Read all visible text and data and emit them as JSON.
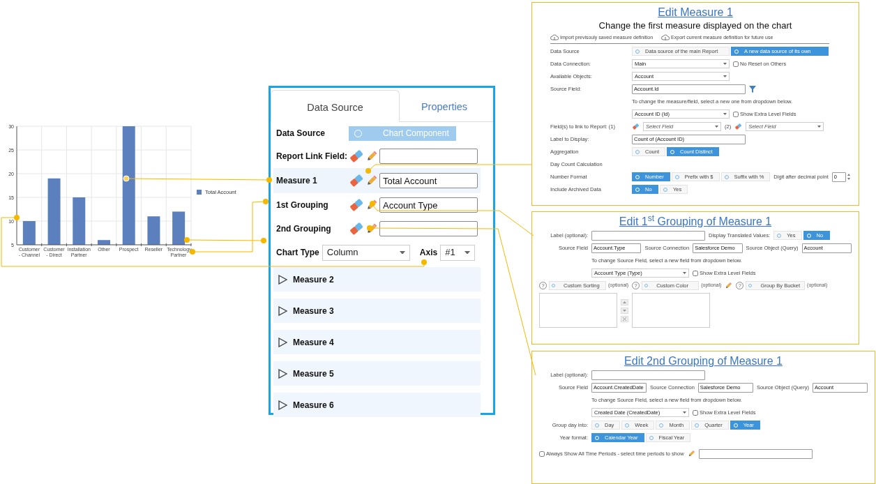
{
  "chart": {
    "chart_data": {
      "type": "bar",
      "categories": [
        "Customer - Channel",
        "Customer - Direct",
        "Installation Partner",
        "Other",
        "Prospect",
        "Reseller",
        "Technology Partner"
      ],
      "series": [
        {
          "name": "Total Account",
          "color": "#5b80bd",
          "values": [
            10,
            19,
            15,
            6,
            30,
            11,
            12
          ]
        }
      ],
      "ylim": [
        5,
        30
      ],
      "yticks": [
        5,
        10,
        15,
        20,
        25,
        30
      ],
      "grid": true
    }
  },
  "panel": {
    "tabs": [
      {
        "label": "Data Source",
        "selected": true
      },
      {
        "label": "Properties",
        "selected": false
      }
    ],
    "data_source": {
      "label": "Data Source",
      "option": {
        "label": "Chart Component",
        "selected": false
      }
    },
    "fields": [
      {
        "label": "Report Link Field:",
        "selected": false
      },
      {
        "label": "Measure 1",
        "value": "Total Account",
        "selected": true
      },
      {
        "label": "1st Grouping",
        "value": "Account Type",
        "selected": false
      },
      {
        "label": "2nd Grouping",
        "selected": false
      }
    ],
    "chart_type": {
      "label": "Chart Type",
      "value": "Column"
    },
    "axis": {
      "label": "Axis",
      "value": "#1"
    },
    "measures": [
      {
        "label": "Measure 2",
        "expanded": false
      },
      {
        "label": "Measure 3",
        "expanded": false
      },
      {
        "label": "Measure 4",
        "expanded": false
      },
      {
        "label": "Measure 5",
        "expanded": false
      },
      {
        "label": "Measure 6",
        "expanded": false
      }
    ]
  },
  "callouts": [
    {
      "title": "Edit Measure 1",
      "subtitle": "Change the first measure displayed on the chart",
      "toolbar": [
        "Import previsouly saved measure definition",
        "Export current measure definition for future use"
      ],
      "rows": [
        {
          "kind": "field",
          "label": "Data Source",
          "items": [
            {
              "kind": "segmented",
              "options": [
                {
                  "label": "Data source of the main Report",
                  "selected": false
                },
                {
                  "label": "A new data source of its own",
                  "selected": true
                }
              ]
            }
          ]
        },
        {
          "kind": "field",
          "label": "Data Connection:",
          "items": [
            {
              "kind": "select",
              "value": "Main"
            },
            {
              "kind": "checkbox",
              "label": "No Reset on Others",
              "checked": false
            }
          ]
        },
        {
          "kind": "field",
          "label": "Available Objects:",
          "items": [
            {
              "kind": "select",
              "value": "Account"
            }
          ]
        },
        {
          "kind": "field",
          "label": "Source Field:",
          "items": [
            {
              "kind": "input",
              "value": "Account.Id"
            },
            {
              "kind": "filter"
            }
          ]
        },
        {
          "kind": "sub",
          "items": [
            {
              "kind": "hint",
              "text": "To change the measure/field, select a new one from dropdown below."
            }
          ]
        },
        {
          "kind": "sub",
          "items": [
            {
              "kind": "select",
              "value": "Account ID (Id)"
            },
            {
              "kind": "checkbox",
              "label": "Show Extra Level Fields",
              "checked": false
            }
          ]
        },
        {
          "kind": "field",
          "label": "Field(s) to link to Report: (1)",
          "items": [
            {
              "kind": "eraser"
            },
            {
              "kind": "select",
              "placeholder": "Select Field"
            },
            {
              "kind": "text",
              "text": "(2)"
            },
            {
              "kind": "eraser"
            },
            {
              "kind": "select",
              "placeholder": "Select Field"
            }
          ]
        },
        {
          "kind": "field",
          "label": "Label to Display:",
          "items": [
            {
              "kind": "input",
              "value": "Count of (Account ID)"
            }
          ]
        },
        {
          "kind": "field",
          "label": "Aggregation",
          "items": [
            {
              "kind": "segmented",
              "options": [
                {
                  "label": "Count",
                  "selected": false
                },
                {
                  "label": "Count Distinct",
                  "selected": true
                }
              ]
            }
          ]
        },
        {
          "kind": "field",
          "label": "Day Count Calculation"
        },
        {
          "kind": "field",
          "label": "Number Format",
          "items": [
            {
              "kind": "segmented",
              "options": [
                {
                  "label": "Number",
                  "selected": true
                },
                {
                  "label": "Prefix with $",
                  "selected": false
                },
                {
                  "label": "Suffix with %",
                  "selected": false
                }
              ]
            },
            {
              "kind": "text",
              "text": "Digit after decimal point"
            },
            {
              "kind": "spinner",
              "value": "0"
            }
          ]
        },
        {
          "kind": "field",
          "label": "Include Archived Data",
          "items": [
            {
              "kind": "segmented",
              "options": [
                {
                  "label": "No",
                  "selected": true
                },
                {
                  "label": "Yes",
                  "selected": false
                }
              ]
            }
          ]
        }
      ]
    },
    {
      "title": "Edit 1$^{st}$ Grouping of Measure 1",
      "rows": [
        {
          "kind": "field",
          "label": "Label (optional):",
          "items": [
            {
              "kind": "input"
            },
            {
              "kind": "text",
              "text": "Display Translated Values:"
            },
            {
              "kind": "segmented",
              "options": [
                {
                  "label": "Yes",
                  "selected": false
                },
                {
                  "label": "No",
                  "selected": true
                }
              ]
            }
          ]
        },
        {
          "kind": "field",
          "label": "Source Field",
          "items": [
            {
              "kind": "input",
              "value": "Account.Type"
            },
            {
              "kind": "text",
              "text": "Source Connection"
            },
            {
              "kind": "input",
              "value": "Salesforce Demo"
            },
            {
              "kind": "text",
              "text": "Source Object (Query)"
            },
            {
              "kind": "input",
              "value": "Account"
            }
          ]
        },
        {
          "kind": "sub",
          "items": [
            {
              "kind": "hint",
              "text": "To change Source Field, select a new field from dropdown below."
            }
          ]
        },
        {
          "kind": "sub",
          "items": [
            {
              "kind": "select",
              "value": "Account Type (Type)"
            },
            {
              "kind": "checkbox",
              "label": "Show Extra Level Fields",
              "checked": false
            }
          ]
        },
        {
          "kind": "plain",
          "items": [
            {
              "kind": "toggle",
              "help": "?",
              "label": "Custom Sorting",
              "selected": false,
              "note": "(optional)"
            },
            {
              "kind": "toggle",
              "help": "?",
              "label": "Custom Color",
              "selected": false,
              "note": "(optional)"
            },
            {
              "kind": "pencil"
            },
            {
              "kind": "toggle",
              "help": "?",
              "label": "Group By Bucket",
              "selected": false,
              "note": "(optional)"
            }
          ]
        },
        {
          "kind": "plain",
          "items": [
            {
              "kind": "listbox"
            },
            {
              "kind": "list_buttons"
            },
            {
              "kind": "listbox"
            }
          ]
        }
      ]
    },
    {
      "title": "Edit 2nd Grouping of Measure 1",
      "rows": [
        {
          "kind": "field",
          "label": "Label (optional):",
          "items": [
            {
              "kind": "input"
            }
          ]
        },
        {
          "kind": "field",
          "label": "Source Field",
          "items": [
            {
              "kind": "input",
              "value": "Account.CreatedDate"
            },
            {
              "kind": "text",
              "text": "Source Connection"
            },
            {
              "kind": "input",
              "value": "Salesforce Demo"
            },
            {
              "kind": "text",
              "text": "Source Object (Query)"
            },
            {
              "kind": "input",
              "value": "Account"
            }
          ]
        },
        {
          "kind": "sub",
          "items": [
            {
              "kind": "hint",
              "text": "To change Source Field, select a new field from dropdown below."
            }
          ]
        },
        {
          "kind": "sub",
          "items": [
            {
              "kind": "select",
              "value": "Created Date (CreatedDate)"
            },
            {
              "kind": "checkbox",
              "label": "Show Extra Level Fields",
              "checked": false
            }
          ]
        },
        {
          "kind": "field",
          "label": "Group day into:",
          "items": [
            {
              "kind": "segmented",
              "options": [
                {
                  "label": "Day",
                  "selected": false
                },
                {
                  "label": "Week",
                  "selected": false
                },
                {
                  "label": "Month",
                  "selected": false
                },
                {
                  "label": "Quarter",
                  "selected": false
                },
                {
                  "label": "Year",
                  "selected": true
                }
              ]
            }
          ]
        },
        {
          "kind": "field",
          "label": "Year format:",
          "items": [
            {
              "kind": "segmented",
              "options": [
                {
                  "label": "Calendar Year",
                  "selected": true
                },
                {
                  "label": "Fiscal Year",
                  "selected": false
                }
              ]
            }
          ]
        },
        {
          "kind": "plain",
          "items": [
            {
              "kind": "checkbox",
              "label": "Always Show All Time Periods - select time periods to show",
              "checked": false
            },
            {
              "kind": "pencil"
            },
            {
              "kind": "input"
            }
          ]
        }
      ]
    }
  ]
}
